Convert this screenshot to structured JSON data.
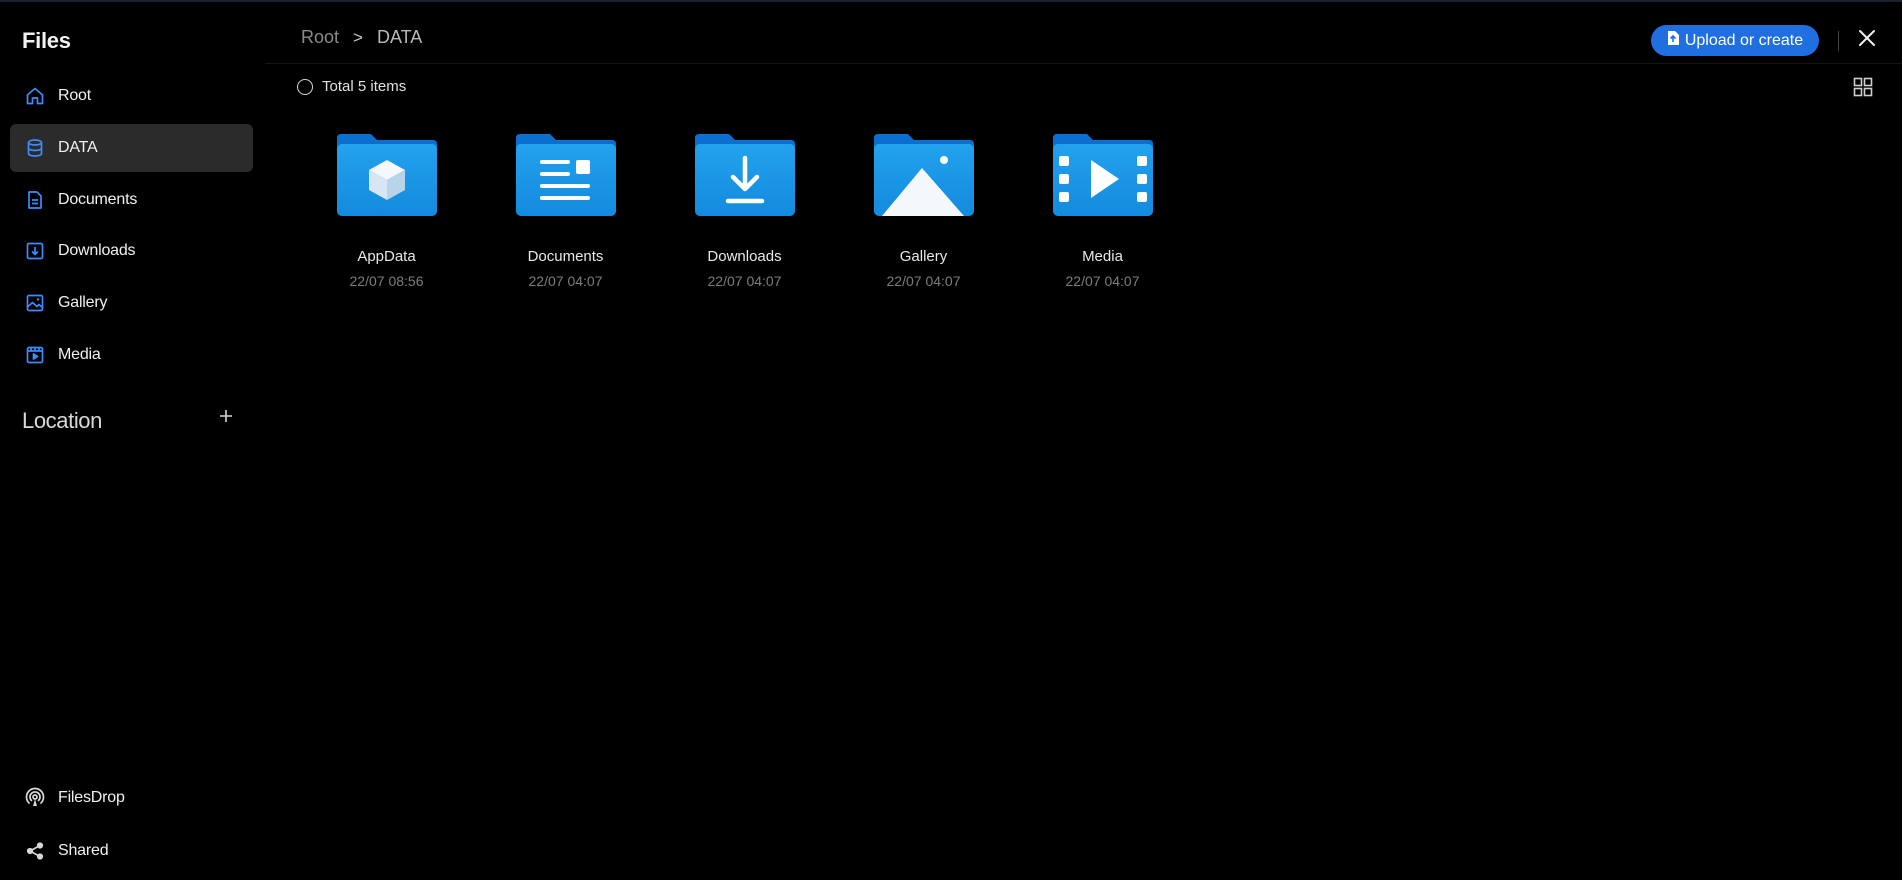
{
  "app": {
    "title": "Files"
  },
  "sidebar": {
    "items": [
      {
        "label": "Root",
        "icon": "home-icon"
      },
      {
        "label": "DATA",
        "icon": "database-icon",
        "active": true
      },
      {
        "label": "Documents",
        "icon": "document-icon"
      },
      {
        "label": "Downloads",
        "icon": "download-icon"
      },
      {
        "label": "Gallery",
        "icon": "image-icon"
      },
      {
        "label": "Media",
        "icon": "video-icon"
      }
    ],
    "location_title": "Location",
    "bottom": [
      {
        "label": "FilesDrop",
        "icon": "airdrop-icon"
      },
      {
        "label": "Shared",
        "icon": "share-icon"
      }
    ]
  },
  "header": {
    "breadcrumb": {
      "root": "Root",
      "separator": ">",
      "current": "DATA"
    },
    "upload_label": "Upload or create"
  },
  "toolbar": {
    "total_text": "Total 5 items"
  },
  "folders": [
    {
      "name": "AppData",
      "date": "22/07 08:56",
      "glyph": "cube-icon"
    },
    {
      "name": "Documents",
      "date": "22/07 04:07",
      "glyph": "document-lines-icon"
    },
    {
      "name": "Downloads",
      "date": "22/07 04:07",
      "glyph": "download-arrow-icon"
    },
    {
      "name": "Gallery",
      "date": "22/07 04:07",
      "glyph": "mountain-icon"
    },
    {
      "name": "Media",
      "date": "22/07 04:07",
      "glyph": "film-play-icon"
    }
  ],
  "colors": {
    "accent": "#1f6fe0",
    "sidebar_icon": "#3d8bfd",
    "active_bg": "#2b2b2b",
    "folder_back": "#0b6fcf",
    "folder_front": "#1a9be8"
  }
}
